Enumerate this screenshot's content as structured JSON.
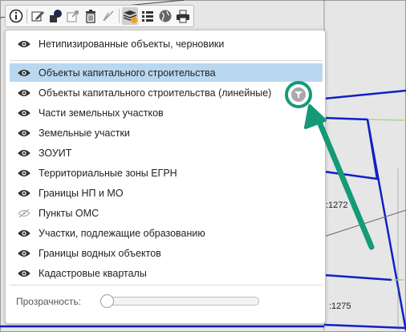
{
  "map": {
    "parcel_labels": [
      ":1272",
      ":1275"
    ]
  },
  "toolbar": {
    "buttons": [
      {
        "name": "info-icon"
      },
      {
        "name": "edit-icon"
      },
      {
        "name": "shapes-icon"
      },
      {
        "name": "export-icon"
      },
      {
        "name": "trash-icon"
      },
      {
        "name": "measure-icon"
      },
      {
        "name": "layers-icon",
        "active": true
      },
      {
        "name": "list-icon"
      },
      {
        "name": "globe-icon"
      },
      {
        "name": "print-icon"
      }
    ]
  },
  "layers": {
    "items": [
      {
        "label": "Нетипизированные объекты, черновики",
        "visible": true,
        "selected": false
      },
      {
        "label": "Объекты капитального строительства",
        "visible": true,
        "selected": true
      },
      {
        "label": "Объекты капитального строительства (линейные)",
        "visible": true,
        "selected": false
      },
      {
        "label": "Части земельных участков",
        "visible": true,
        "selected": false
      },
      {
        "label": "Земельные участки",
        "visible": true,
        "selected": false
      },
      {
        "label": "ЗОУИТ",
        "visible": true,
        "selected": false
      },
      {
        "label": "Территориальные зоны ЕГРН",
        "visible": true,
        "selected": false
      },
      {
        "label": "Границы НП и МО",
        "visible": true,
        "selected": false
      },
      {
        "label": "Пункты ОМС",
        "visible": false,
        "selected": false
      },
      {
        "label": "Участки, подлежащие образованию",
        "visible": true,
        "selected": false
      },
      {
        "label": "Границы водных объектов",
        "visible": true,
        "selected": false
      },
      {
        "label": "Кадастровые кварталы",
        "visible": true,
        "selected": false
      }
    ],
    "opacity_label": "Прозрачность:",
    "opacity_value": 0
  },
  "colors": {
    "accent": "#159a78",
    "selection": "#b9d8f0",
    "map_boundary": "#1020c8"
  }
}
